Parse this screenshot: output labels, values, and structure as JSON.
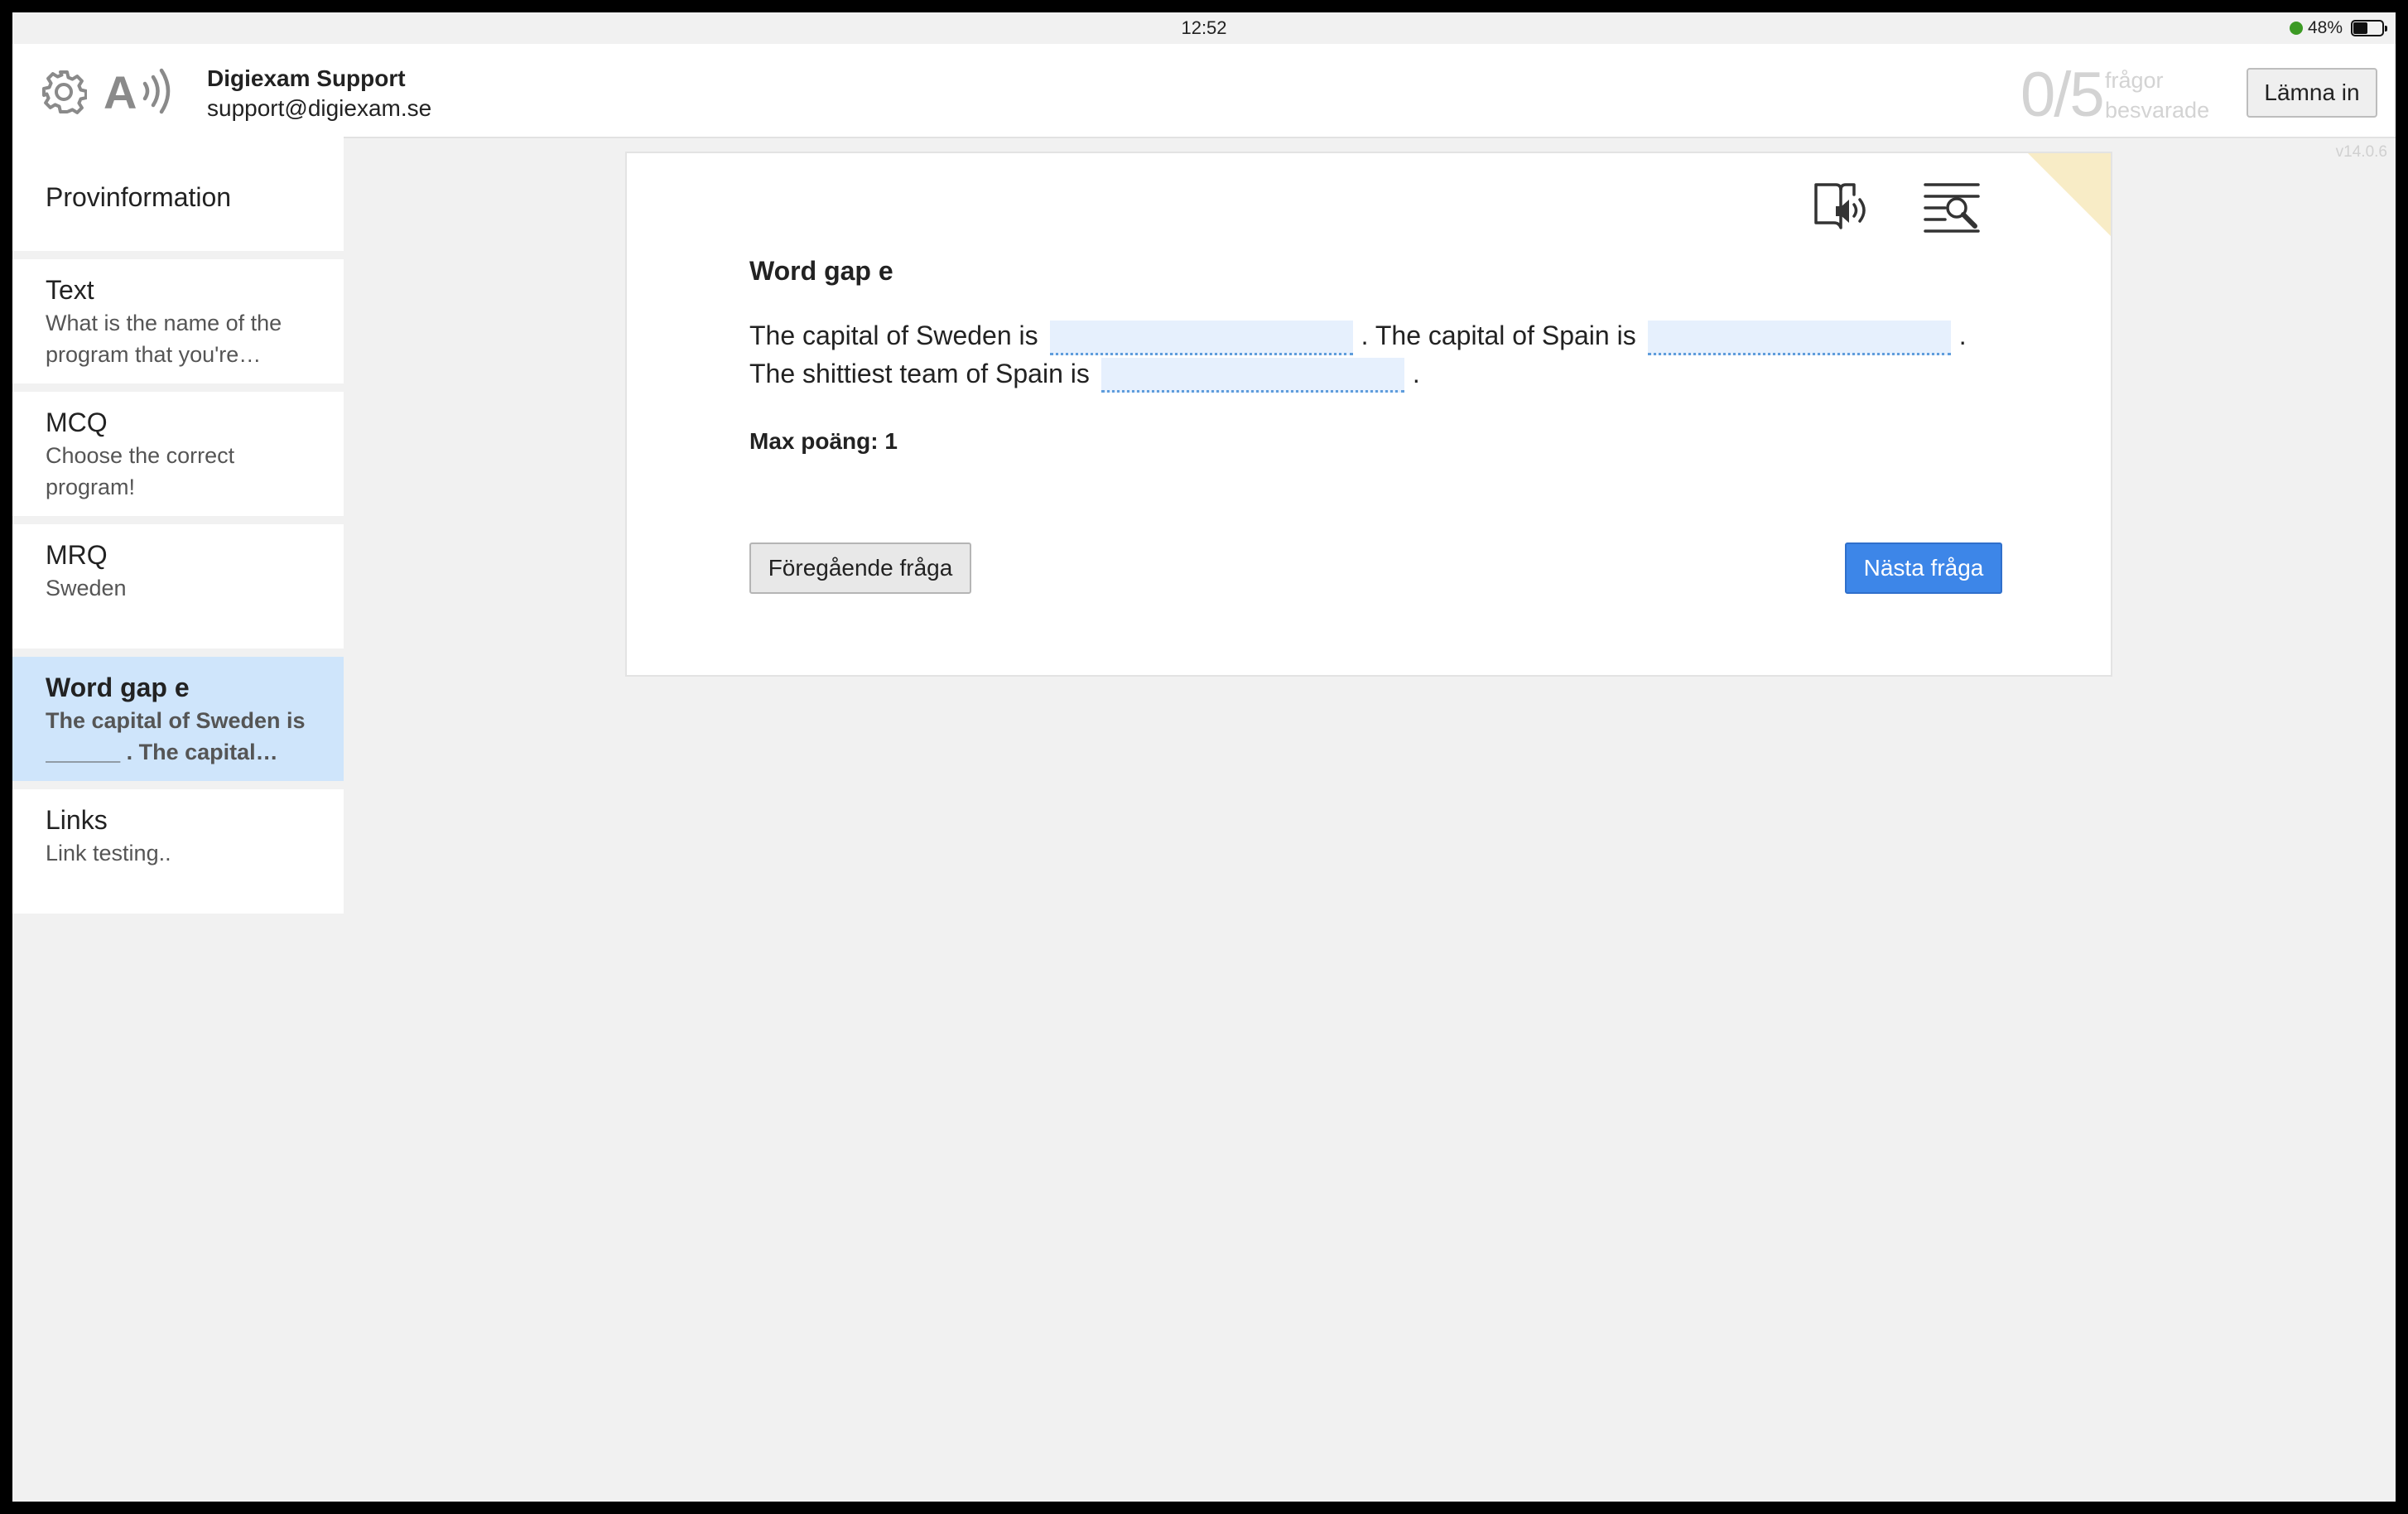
{
  "status_bar": {
    "time": "12:52",
    "battery": "48%",
    "battery_level": 0.48
  },
  "header": {
    "user_name": "Digiexam Support",
    "user_email": "support@digiexam.se",
    "answered_count": "0/5",
    "answered_label": "frågor besvarade",
    "submit_label": "Lämna in",
    "version": "v14.0.6"
  },
  "sidebar": {
    "info_label": "Provinformation",
    "items": [
      {
        "title": "Text",
        "subtitle": "What is the name of the program that you're…"
      },
      {
        "title": "MCQ",
        "subtitle": "Choose the correct program!"
      },
      {
        "title": "MRQ",
        "subtitle": "Sweden"
      },
      {
        "title": "Word gap e",
        "subtitle": "The capital of Sweden is ______ .  The capital…",
        "active": true
      },
      {
        "title": "Links",
        "subtitle": "Link testing.."
      }
    ]
  },
  "question": {
    "title": "Word gap e",
    "segments": [
      "The capital of Sweden is",
      ".  The capital of Spain is",
      ".",
      "The shittiest team of Spain is",
      "."
    ],
    "gaps": [
      "",
      "",
      ""
    ],
    "max_points": "Max poäng: 1",
    "prev_label": "Föregående fråga",
    "next_label": "Nästa fråga"
  },
  "icons": {
    "settings": "gear-icon",
    "text_to_speech": "text-to-speech-icon",
    "read_aloud": "read-aloud-icon",
    "search_text": "search-text-icon"
  },
  "colors": {
    "accent": "#3d86e8",
    "active_item": "#cfe5fb",
    "gap_fill": "#e6f0fd",
    "gap_underline": "#5f9ddc",
    "corner_note": "#f8ecc6",
    "status_dot": "#3c9a24"
  }
}
